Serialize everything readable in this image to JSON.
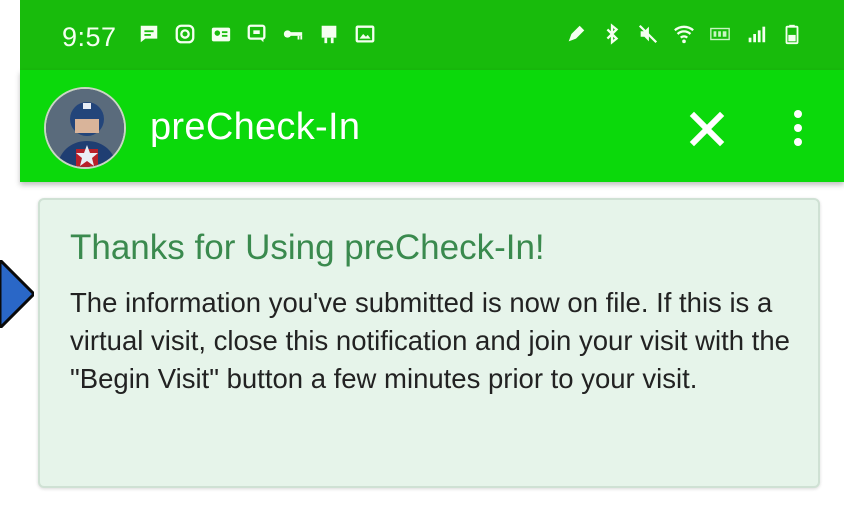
{
  "status_bar": {
    "time": "9:57",
    "left_icons": [
      "message-icon",
      "instagram-icon",
      "contact-card-icon",
      "chat-icon",
      "key-icon",
      "sim-icon",
      "image-icon"
    ],
    "right_icons": [
      "stylus-icon",
      "bluetooth-icon",
      "mute-icon",
      "wifi-icon",
      "lte-icon",
      "signal-icon",
      "battery-icon"
    ],
    "bar_color": "#18bb0c"
  },
  "app_bar": {
    "title": "preCheck-In",
    "color": "#0bd90b",
    "avatar": "user-avatar"
  },
  "notification": {
    "title": "Thanks for Using preCheck-In!",
    "body": "The information you've submitted is now on file. If this is a virtual visit, close this notification and join your visit with the \"Begin Visit\" button a few minutes prior to your visit.",
    "title_color": "#3a8a4e",
    "background": "#e6f4ea"
  }
}
